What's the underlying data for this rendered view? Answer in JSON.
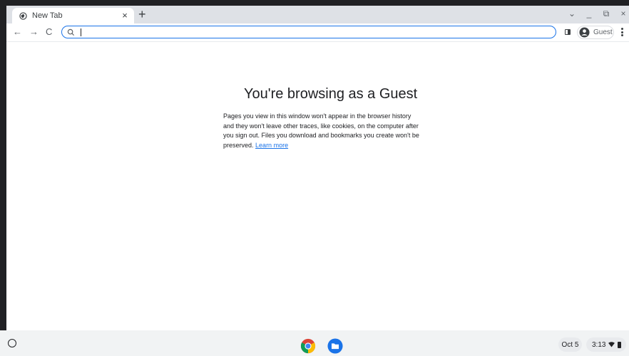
{
  "browser": {
    "tab_title": "New Tab",
    "tab_close": "×",
    "new_tab": "+",
    "window_controls": {
      "dropdown": "⌄",
      "minimize": "_",
      "restore": "⧉",
      "close": "×"
    },
    "nav": {
      "back": "←",
      "forward": "→",
      "reload": "C"
    },
    "omnibox_value": "",
    "guest_label": "Guest"
  },
  "page": {
    "heading": "You're browsing as a Guest",
    "body": "Pages you view in this window won't appear in the browser history and they won't leave other traces, like cookies, on the computer after you sign out. Files you download and bookmarks you create won't be preserved.",
    "link": "Learn more"
  },
  "shelf": {
    "apps": [
      "chrome-icon",
      "files-icon"
    ],
    "date": "Oct 5",
    "time": "3:13"
  },
  "colors": {
    "accent": "#1a73e8",
    "tabstrip": "#dee1e6",
    "shelf": "#f1f3f4"
  }
}
